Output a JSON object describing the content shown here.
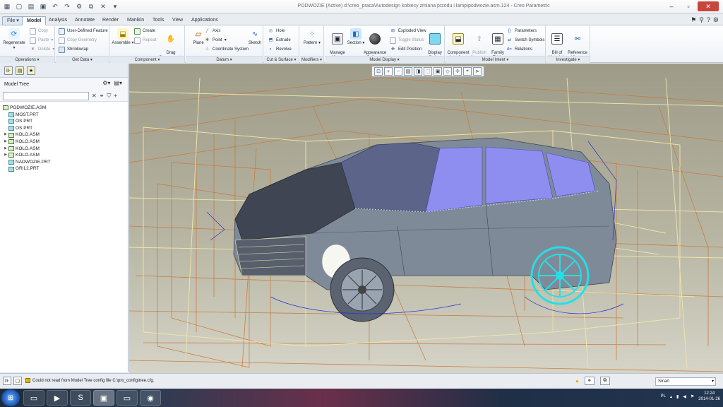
{
  "window": {
    "title": "PODWOZIE (Active) d:\\creo_praca\\Autodesign kobiecy zmiana przodu i lamp\\podwozie.asm.124 - Creo Parametric"
  },
  "tabs": [
    "Model",
    "Analysis",
    "Annotate",
    "Render",
    "Manikin",
    "Tools",
    "View",
    "Applications"
  ],
  "file_tab": "File",
  "ribbon": {
    "operations": {
      "label": "Operations",
      "regenerate": "Regenerate",
      "copy": "Copy",
      "paste": "Paste",
      "delete": "Delete"
    },
    "get_data": {
      "label": "Get Data",
      "user_defined_feature": "User-Defined Feature",
      "copy_geometry": "Copy Geometry",
      "shrinkwrap": "Shrinkwrap"
    },
    "component": {
      "label": "Component",
      "assemble": "Assemble",
      "create": "Create",
      "repeat": "Repeat",
      "drag": "Drag\nComponents"
    },
    "datum": {
      "label": "Datum",
      "plane": "Plane",
      "axis": "Axis",
      "point": "Point",
      "csys": "Coordinate System",
      "sketch": "Sketch"
    },
    "cut_surface": {
      "label": "Cut & Surface",
      "hole": "Hole",
      "extrude": "Extrude",
      "revolve": "Revolve"
    },
    "modifiers": {
      "label": "Modifiers",
      "pattern": "Pattern"
    },
    "model_display": {
      "label": "Model Display",
      "manage_views": "Manage\nViews",
      "section": "Section",
      "appearance": "Appearance\nGallery",
      "exploded": "Exploded View",
      "toggle_status": "Toggle Status",
      "edit_position": "Edit Position",
      "display_style": "Display\nStyle"
    },
    "model_intent": {
      "label": "Model Intent",
      "component_interface": "Component\nInterface",
      "publish_geometry": "Publish\nGeometry",
      "family_table": "Family\nTable",
      "parameters": "Parameters",
      "switch_symbols": "Switch Symbols",
      "relations": "Relations"
    },
    "investigate": {
      "label": "Investigate",
      "bom": "Bill of\nMaterials",
      "reference_viewer": "Reference\nViewer"
    }
  },
  "model_tree": {
    "title": "Model Tree",
    "items": [
      {
        "name": "PODWOZIE.ASM",
        "type": "asm",
        "level": 0,
        "expandable": false
      },
      {
        "name": "MOST.PRT",
        "type": "prt",
        "level": 1,
        "expandable": false
      },
      {
        "name": "OS.PRT",
        "type": "prt",
        "level": 1,
        "expandable": false
      },
      {
        "name": "OS.PRT",
        "type": "prt",
        "level": 1,
        "expandable": false
      },
      {
        "name": "KOLO.ASM",
        "type": "asm",
        "level": 1,
        "expandable": true
      },
      {
        "name": "KOLO.ASM",
        "type": "asm",
        "level": 1,
        "expandable": true
      },
      {
        "name": "KOLO.ASM",
        "type": "asm",
        "level": 1,
        "expandable": true
      },
      {
        "name": "KOLO.ASM",
        "type": "asm",
        "level": 1,
        "expandable": true
      },
      {
        "name": "NADWOZIE.PRT",
        "type": "prt",
        "level": 1,
        "expandable": false
      },
      {
        "name": "GRIL2.PRT",
        "type": "prt",
        "level": 1,
        "expandable": false
      }
    ]
  },
  "status": {
    "message": "Could not read from Model Tree config file C:\\pro_config\\tree.cfg.",
    "selection_filter": "Smart"
  },
  "taskbar": {
    "language": "PL",
    "time": "12:24",
    "date": "2014-01-26"
  },
  "colors": {
    "selected_wheel": "#22e0e6",
    "glass": "#8e8ef0",
    "body": "#7f8a99",
    "datum_orange": "#c9773a",
    "datum_yellow": "#f2e6a8"
  }
}
